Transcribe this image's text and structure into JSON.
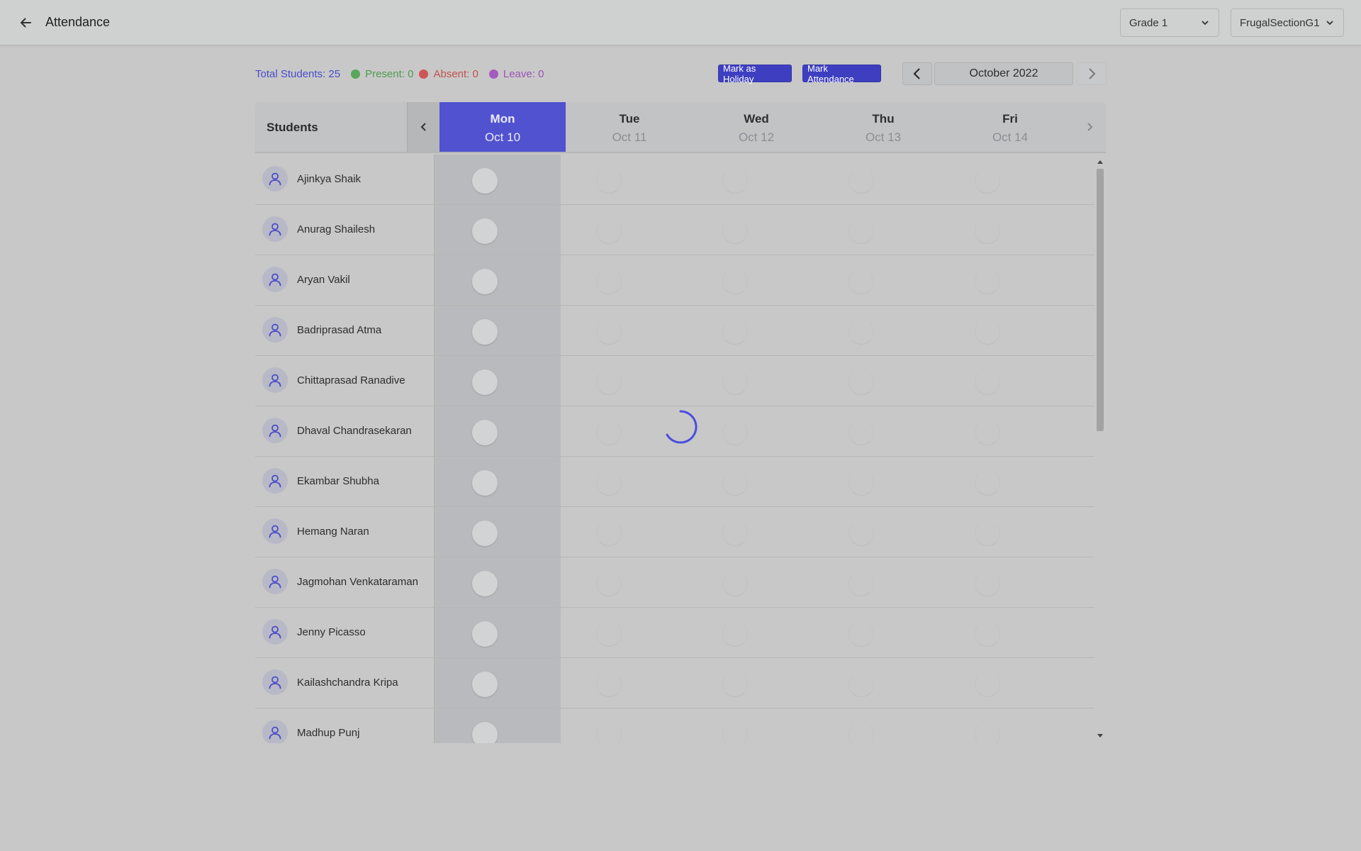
{
  "header": {
    "title": "Attendance",
    "grade_select": "Grade 1",
    "section_select": "FrugalSectionG1"
  },
  "stats": {
    "total": "Total Students: 25",
    "present": "Present: 0",
    "absent": "Absent: 0",
    "leave": "Leave: 0"
  },
  "actions": {
    "mark_holiday": "Mark as Holiday",
    "mark_attendance": "Mark Attendance"
  },
  "month": "October 2022",
  "grid": {
    "students_label": "Students",
    "days": [
      {
        "name": "Mon",
        "date": "Oct 10",
        "active": true
      },
      {
        "name": "Tue",
        "date": "Oct 11",
        "active": false
      },
      {
        "name": "Wed",
        "date": "Oct 12",
        "active": false
      },
      {
        "name": "Thu",
        "date": "Oct 13",
        "active": false
      },
      {
        "name": "Fri",
        "date": "Oct 14",
        "active": false
      }
    ],
    "students": [
      "Ajinkya Shaik",
      "Anurag Shailesh",
      "Aryan Vakil",
      "Badriprasad Atma",
      "Chittaprasad Ranadive",
      "Dhaval Chandrasekaran",
      "Ekambar Shubha",
      "Hemang Naran",
      "Jagmohan Venkataraman",
      "Jenny Picasso",
      "Kailashchandra Kripa",
      "Madhup Punj"
    ]
  },
  "colors": {
    "accent": "#5052cf",
    "stats_total": "#4a4cc9",
    "present": "#5aa65a",
    "absent": "#cf5656",
    "leave": "#a45bc0",
    "present_text": "#4f9a4f",
    "absent_text": "#c0504e",
    "leave_text": "#9a52b5"
  },
  "icons": {
    "back": "arrow-left-icon",
    "dropdown": "chevron-down-icon",
    "prev": "chevron-left-icon",
    "next": "chevron-right-icon",
    "avatar": "user-icon",
    "loading": "spinner-icon"
  }
}
